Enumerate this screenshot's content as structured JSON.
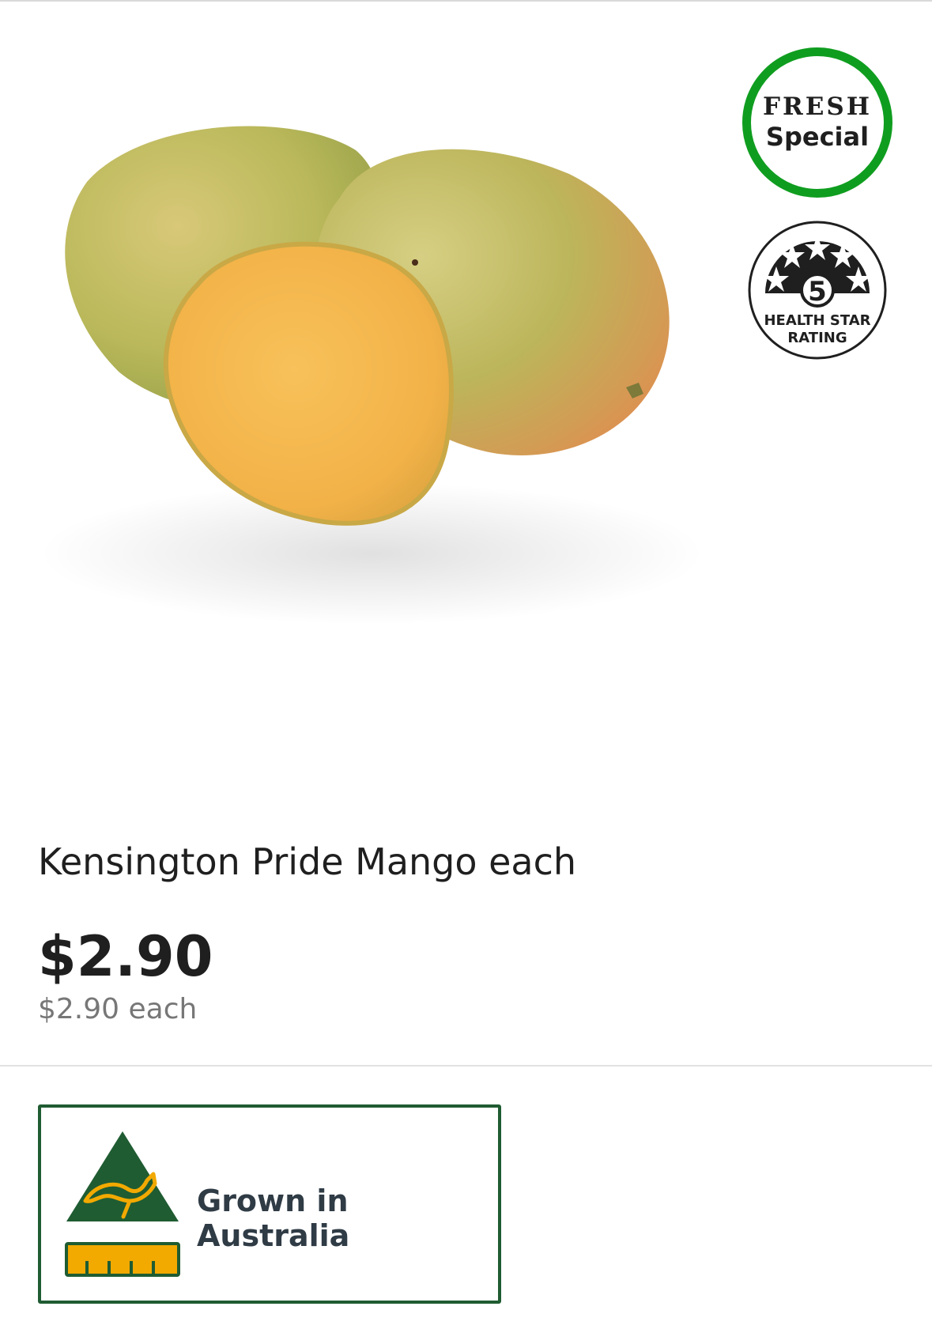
{
  "product": {
    "title": "Kensington Pride Mango each",
    "price": "$2.90",
    "unit_price": "$2.90 each"
  },
  "badges": {
    "fresh_line1": "FRESH",
    "fresh_line2": "Special",
    "fresh_color": "#0f9d1f",
    "health_star_rating": "5",
    "health_star_line1": "HEALTH STAR",
    "health_star_line2": "RATING"
  },
  "origin": {
    "label": "Grown in Australia",
    "icon": "kangaroo-triangle-icon",
    "colors": {
      "green": "#1f5c32",
      "gold": "#f2a900"
    }
  }
}
